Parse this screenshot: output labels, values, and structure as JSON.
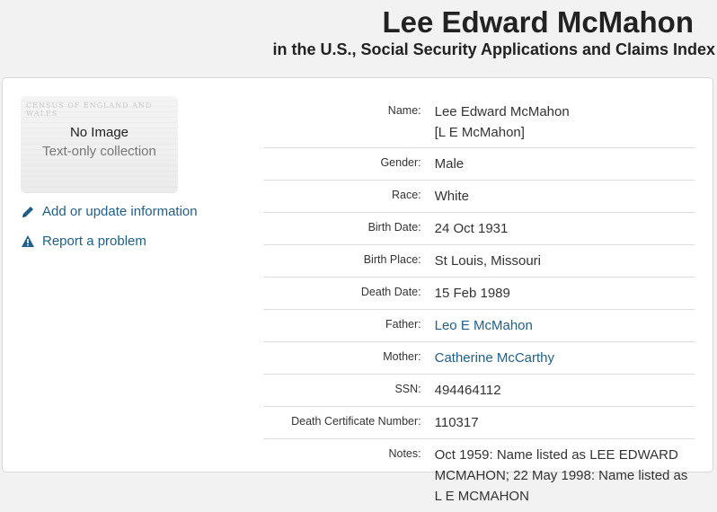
{
  "header": {
    "title": "Lee Edward McMahon",
    "subtitle": "in the U.S., Social Security Applications and Claims Index"
  },
  "thumbnail": {
    "scan_text": "CENSUS OF ENGLAND AND WALES",
    "no_image": "No Image",
    "text_only": "Text-only collection"
  },
  "actions": {
    "add": "Add or update information",
    "report": "Report a problem"
  },
  "record": {
    "name_label": "Name:",
    "name_value": "Lee Edward McMahon",
    "name_alt": "[L E McMahon]",
    "gender_label": "Gender:",
    "gender_value": "Male",
    "race_label": "Race:",
    "race_value": "White",
    "birth_date_label": "Birth Date:",
    "birth_date_value": "24 Oct 1931",
    "birth_place_label": "Birth Place:",
    "birth_place_value": "St Louis, Missouri",
    "death_date_label": "Death Date:",
    "death_date_value": "15 Feb 1989",
    "father_label": "Father:",
    "father_value": "Leo E McMahon",
    "mother_label": "Mother:",
    "mother_value": "Catherine McCarthy",
    "ssn_label": "SSN:",
    "ssn_value": "494464112",
    "death_cert_label": "Death Certificate Number:",
    "death_cert_value": "110317",
    "notes_label": "Notes:",
    "notes_value": "Oct 1959: Name listed as LEE EDWARD MCMAHON; 22 May 1998: Name listed as L E MCMAHON"
  },
  "colors": {
    "link": "#1f5f89",
    "text": "#333333",
    "background": "#f2f2f2"
  }
}
